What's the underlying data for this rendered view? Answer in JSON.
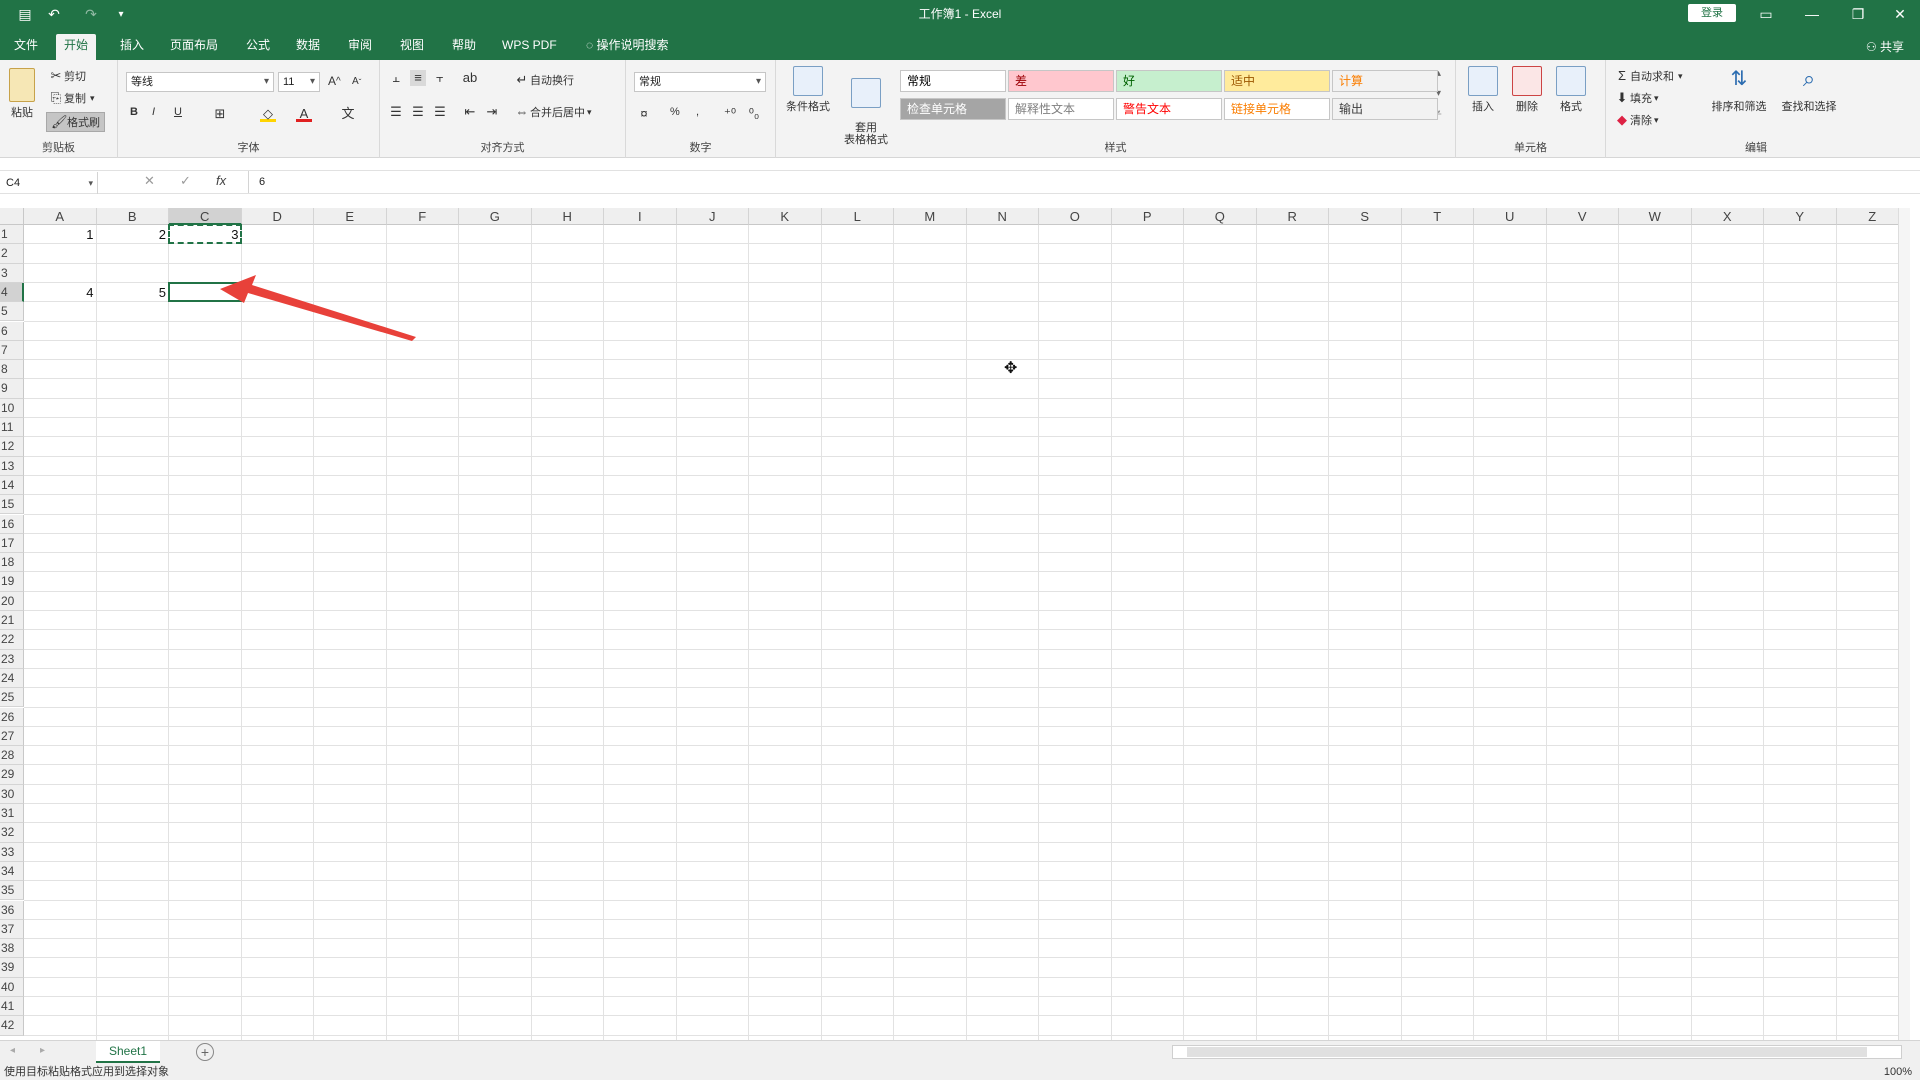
{
  "window": {
    "title": "工作簿1 - Excel",
    "login_label": "登录",
    "share_label": "共享"
  },
  "quick_access": {
    "icons": [
      "save-icon",
      "undo-icon",
      "redo-icon",
      "customize-icon"
    ]
  },
  "tabs": [
    "文件",
    "开始",
    "插入",
    "页面布局",
    "公式",
    "数据",
    "审阅",
    "视图",
    "帮助",
    "WPS PDF",
    "操作说明搜索"
  ],
  "active_tab": "开始",
  "ribbon": {
    "clipboard": {
      "label": "剪贴板",
      "paste": "粘贴",
      "cut": "剪切",
      "copy": "复制",
      "format_painter": "格式刷"
    },
    "font": {
      "label": "字体",
      "font_name": "等线",
      "font_size": "11",
      "bold": "B",
      "italic": "I",
      "underline": "U",
      "font_color_glyph": "A",
      "grow_glyph": "A",
      "shrink_glyph": "A"
    },
    "alignment": {
      "label": "对齐方式",
      "wrap_text": "自动换行",
      "merge_center": "合并后居中"
    },
    "number": {
      "label": "数字",
      "format": "常规",
      "percent": "%",
      "comma": ","
    },
    "styles": {
      "label": "样式",
      "conditional_format": "条件格式",
      "table_format": "套用\n表格格式",
      "cells": [
        {
          "text": "常规",
          "bg": "#ffffff",
          "fg": "#000000"
        },
        {
          "text": "差",
          "bg": "#ffc7ce",
          "fg": "#9c0006"
        },
        {
          "text": "好",
          "bg": "#c6efce",
          "fg": "#006100"
        },
        {
          "text": "适中",
          "bg": "#ffeb9c",
          "fg": "#9c5700"
        },
        {
          "text": "计算",
          "bg": "#f2f2f2",
          "fg": "#fa7d00"
        },
        {
          "text": "检查单元格",
          "bg": "#a5a5a5",
          "fg": "#ffffff"
        },
        {
          "text": "解释性文本",
          "bg": "#ffffff",
          "fg": "#7f7f7f"
        },
        {
          "text": "警告文本",
          "bg": "#ffffff",
          "fg": "#ff0000"
        },
        {
          "text": "链接单元格",
          "bg": "#ffffff",
          "fg": "#fa7d00"
        },
        {
          "text": "输出",
          "bg": "#f2f2f2",
          "fg": "#3f3f3f"
        }
      ]
    },
    "cells": {
      "label": "单元格",
      "insert": "插入",
      "delete": "删除",
      "format": "格式"
    },
    "editing": {
      "label": "编辑",
      "autosum": "自动求和",
      "fill": "填充",
      "clear": "清除",
      "sort_filter": "排序和筛选",
      "find_select": "查找和选择"
    }
  },
  "formula_bar": {
    "name_box": "C4",
    "formula": "6",
    "cancel_glyph": "✕",
    "enter_glyph": "✓",
    "fx_glyph": "fx"
  },
  "columns": [
    "A",
    "B",
    "C",
    "D",
    "E",
    "F",
    "G",
    "H",
    "I",
    "J",
    "K",
    "L",
    "M",
    "N",
    "O",
    "P",
    "Q",
    "R",
    "S",
    "T",
    "U",
    "V",
    "W",
    "X",
    "Y",
    "Z"
  ],
  "rows": [
    "1",
    "2",
    "3",
    "4",
    "5",
    "6",
    "7",
    "8",
    "9",
    "10",
    "11",
    "12",
    "13",
    "14",
    "15",
    "16",
    "17",
    "18",
    "19",
    "20",
    "21",
    "22",
    "23",
    "24",
    "25",
    "26",
    "27",
    "28",
    "29",
    "30",
    "31",
    "32",
    "33",
    "34",
    "35",
    "36",
    "37",
    "38",
    "39",
    "40",
    "41",
    "42"
  ],
  "selected_column": "C",
  "selected_row": "4",
  "cell_values": [
    {
      "ref": "A1",
      "value": "1"
    },
    {
      "ref": "B1",
      "value": "2"
    },
    {
      "ref": "C1",
      "value": "3"
    },
    {
      "ref": "A4",
      "value": "4"
    },
    {
      "ref": "B4",
      "value": "5"
    }
  ],
  "sheets": [
    "Sheet1"
  ],
  "status_text": "使用目标粘贴格式应用到选择对象",
  "zoom": "100%",
  "colors": {
    "accent": "#217346",
    "arrow": "#e8413a"
  }
}
